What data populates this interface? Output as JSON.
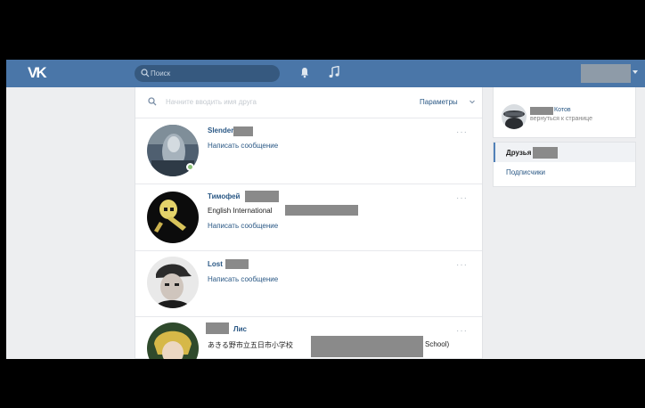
{
  "header": {
    "logo": "VK",
    "search_placeholder": "Поиск"
  },
  "filter": {
    "placeholder": "Начните вводить имя друга",
    "params_label": "Параметры"
  },
  "friends": [
    {
      "name": "Slender",
      "message_label": "Написать сообщение",
      "online": true
    },
    {
      "name": "Тимофей",
      "subtitle": "English International",
      "message_label": "Написать сообщение",
      "online": false
    },
    {
      "name": "Lost",
      "message_label": "Написать сообщение",
      "online": false
    },
    {
      "name": "Лис",
      "subtitle_left": "あきる野市立五日市小学校",
      "subtitle_right": "School)",
      "online": false
    }
  ],
  "more_label": "···",
  "profile": {
    "name": "Котов",
    "back_label": "вернуться к странице"
  },
  "menu": {
    "active": "Друзья",
    "items": [
      "Подписчики"
    ]
  },
  "colors": {
    "header": "#4a76a8",
    "link": "#2a5885",
    "online": "#8ac176"
  }
}
